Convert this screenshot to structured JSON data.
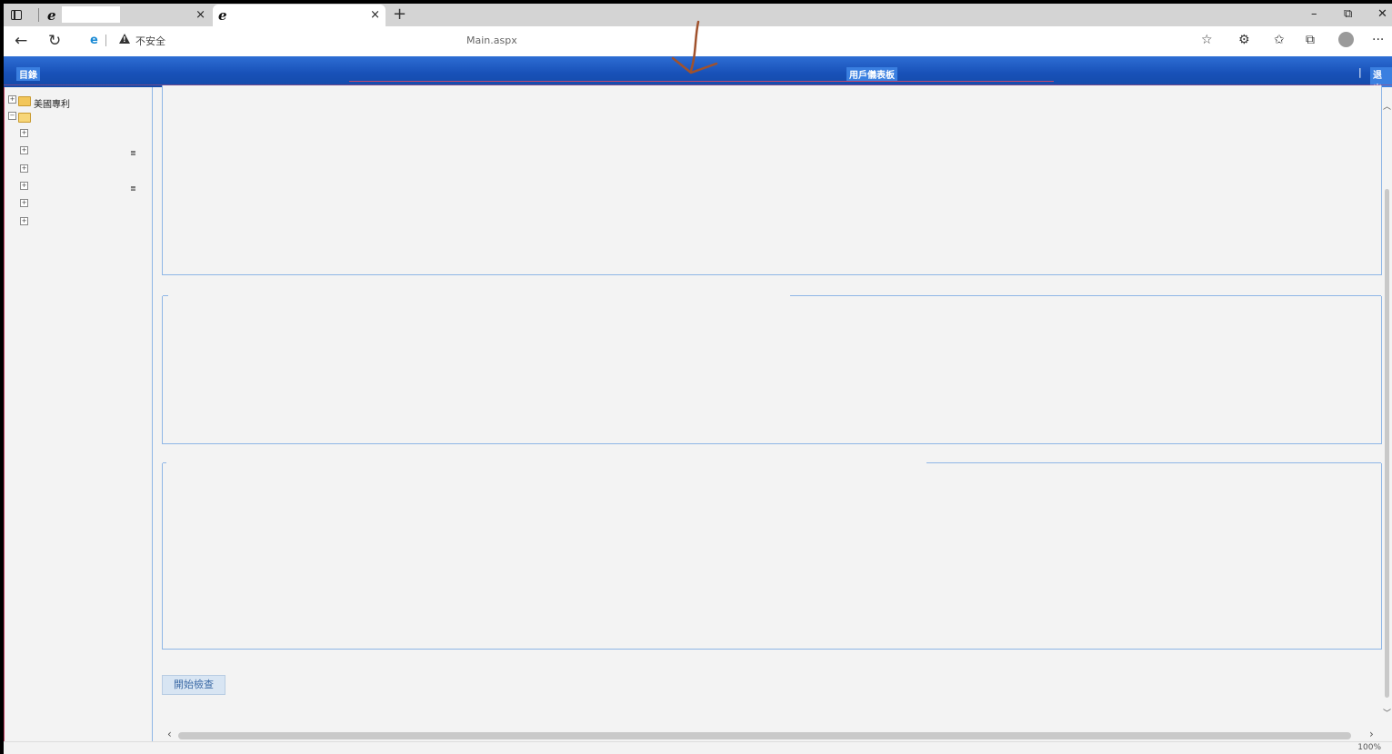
{
  "browser": {
    "tabs": [
      {
        "icon": "ie-icon",
        "close": "×"
      },
      {
        "icon": "ie-icon",
        "close": "×"
      }
    ],
    "new_tab": "+",
    "window": {
      "minimize": "–",
      "restore": "⧉",
      "close": "✕"
    },
    "address": {
      "security_label": "不安全",
      "url_visible": "Main.aspx"
    },
    "toolbar_more": "···"
  },
  "app": {
    "header": {
      "catalog": "目錄",
      "dashboard": "用戶儀表板",
      "separator": "|",
      "logout": "退出"
    },
    "tree": {
      "items": [
        {
          "label": "美國專利",
          "expanded": false
        }
      ]
    },
    "main": {
      "start_button": "開始檢查"
    },
    "status": {
      "zoom": "100%"
    }
  },
  "colors": {
    "header_blue": "#1851b8",
    "border_blue": "#8eb6e6",
    "annotation_brown": "#a0522d"
  }
}
